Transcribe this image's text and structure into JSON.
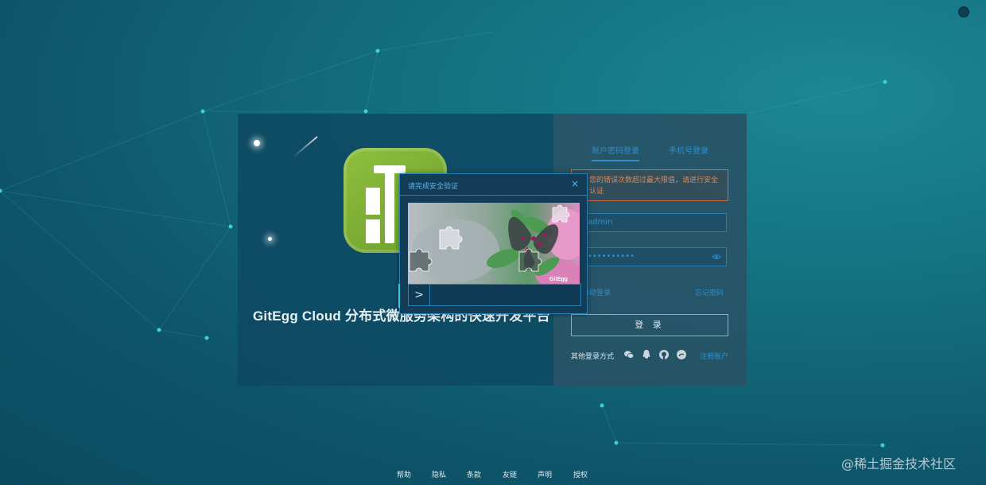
{
  "brand": {
    "title": "GitEgg Cloud 分布式微服务架构的快速开发平台"
  },
  "login": {
    "tabs": [
      {
        "label": "账户密码登录",
        "active": true
      },
      {
        "label": "手机号登录",
        "active": false
      }
    ],
    "alert": "您的错误次数超过最大限值，请进行安全认证",
    "username": {
      "value": "admin"
    },
    "password": {
      "value": "••••••••••"
    },
    "remember_label": "自动登录",
    "forgot_label": "忘记密码",
    "submit_label": "登 录",
    "other_login_label": "其他登录方式",
    "social_icons": [
      "wechat-icon",
      "qq-icon",
      "github-icon",
      "weibo-icon"
    ],
    "register_label": "注册账户"
  },
  "captcha": {
    "title": "请完成安全验证",
    "close": "×",
    "image_watermark": "GitEgg",
    "slider_arrow": ">"
  },
  "footer": {
    "links": [
      "帮助",
      "隐私",
      "条款",
      "友链",
      "声明",
      "授权"
    ]
  },
  "watermark": "@稀土掘金技术社区",
  "colors": {
    "accent": "#2d8fd0",
    "logo_green": "#8fc03d",
    "alert": "#d7895f"
  }
}
